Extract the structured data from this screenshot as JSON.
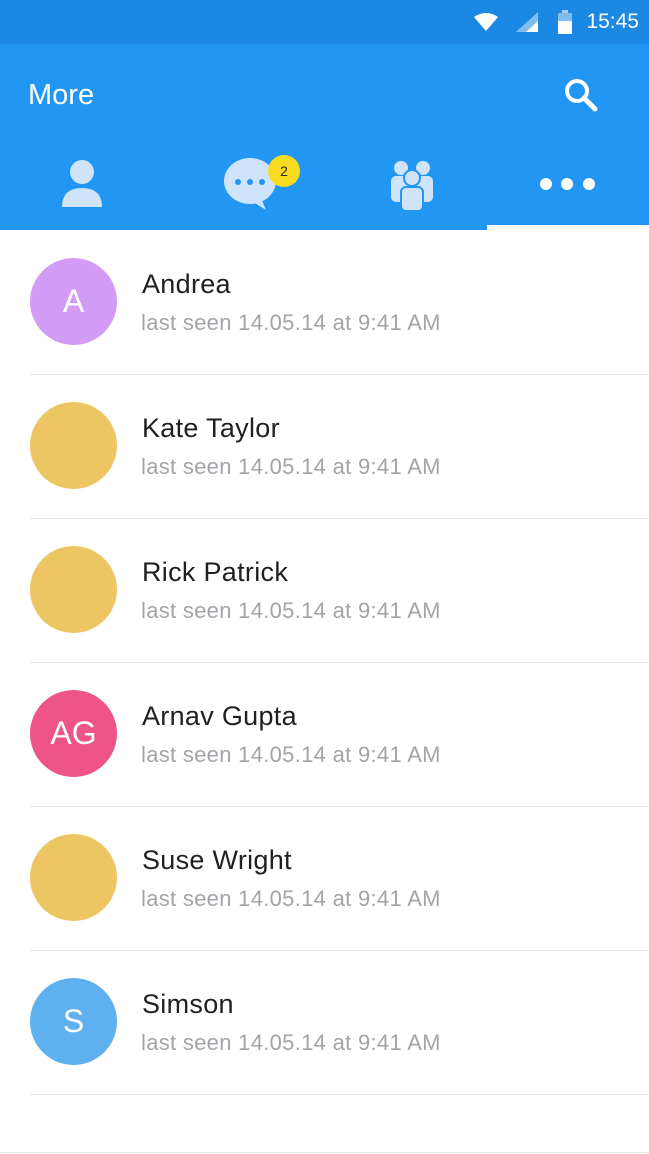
{
  "status_bar": {
    "time": "15:45",
    "icons": [
      "wifi-icon",
      "signal-icon",
      "battery-icon"
    ]
  },
  "header": {
    "title": "More",
    "search_icon": "search-icon",
    "tabs": [
      {
        "icon": "person-icon",
        "selected": false
      },
      {
        "icon": "chat-bubble-icon",
        "badge": "2",
        "selected": false
      },
      {
        "icon": "group-icon",
        "selected": false
      },
      {
        "icon": "more-dots-icon",
        "selected": true
      }
    ]
  },
  "colors": {
    "status_bar": "#1b88e3",
    "app_bar": "#2196f3",
    "badge": "#f9dc1f",
    "name_text": "#1f1f1f",
    "secondary_text": "#a3a3a8"
  },
  "contacts": [
    {
      "name": "Andrea",
      "initials": "A",
      "status": "last seen 14.05.14 at 9:41 AM",
      "avatar_color": "#d39df7"
    },
    {
      "name": "Kate Taylor",
      "initials": "",
      "status": "last seen 14.05.14 at 9:41 AM",
      "avatar_color": "#eec563"
    },
    {
      "name": "Rick Patrick",
      "initials": "",
      "status": "last seen 14.05.14 at 9:41 AM",
      "avatar_color": "#eec563"
    },
    {
      "name": "Arnav Gupta",
      "initials": "AG",
      "status": "last seen 14.05.14 at 9:41 AM",
      "avatar_color": "#ee5487"
    },
    {
      "name": "Suse Wright",
      "initials": "",
      "status": "last seen 14.05.14 at 9:41 AM",
      "avatar_color": "#eec563"
    },
    {
      "name": "Simson",
      "initials": "S",
      "status": "last seen 14.05.14 at 9:41 AM",
      "avatar_color": "#5fb0ef"
    }
  ]
}
